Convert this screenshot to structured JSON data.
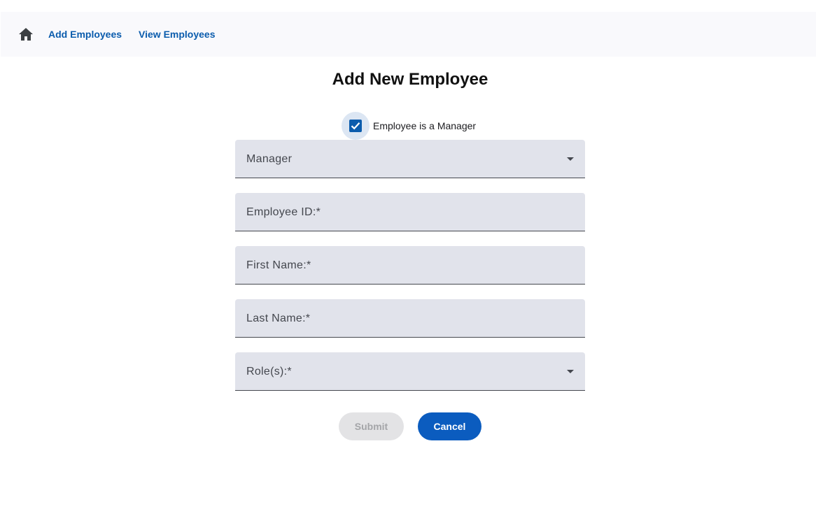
{
  "nav": {
    "home_icon": "home-icon",
    "add_employees": "Add Employees",
    "view_employees": "View Employees"
  },
  "page": {
    "title": "Add New Employee"
  },
  "manager_checkbox": {
    "label": "Employee is a Manager",
    "checked": true
  },
  "form": {
    "manager_label": "Manager",
    "employee_id_label": "Employee ID:*",
    "first_name_label": "First Name:*",
    "last_name_label": "Last Name:*",
    "roles_label": "Role(s):*"
  },
  "buttons": {
    "submit": "Submit",
    "submit_disabled": true,
    "cancel": "Cancel"
  },
  "colors": {
    "accent": "#0b5cbf",
    "link": "#0b5cad",
    "field_bg": "#e1e3eb"
  }
}
